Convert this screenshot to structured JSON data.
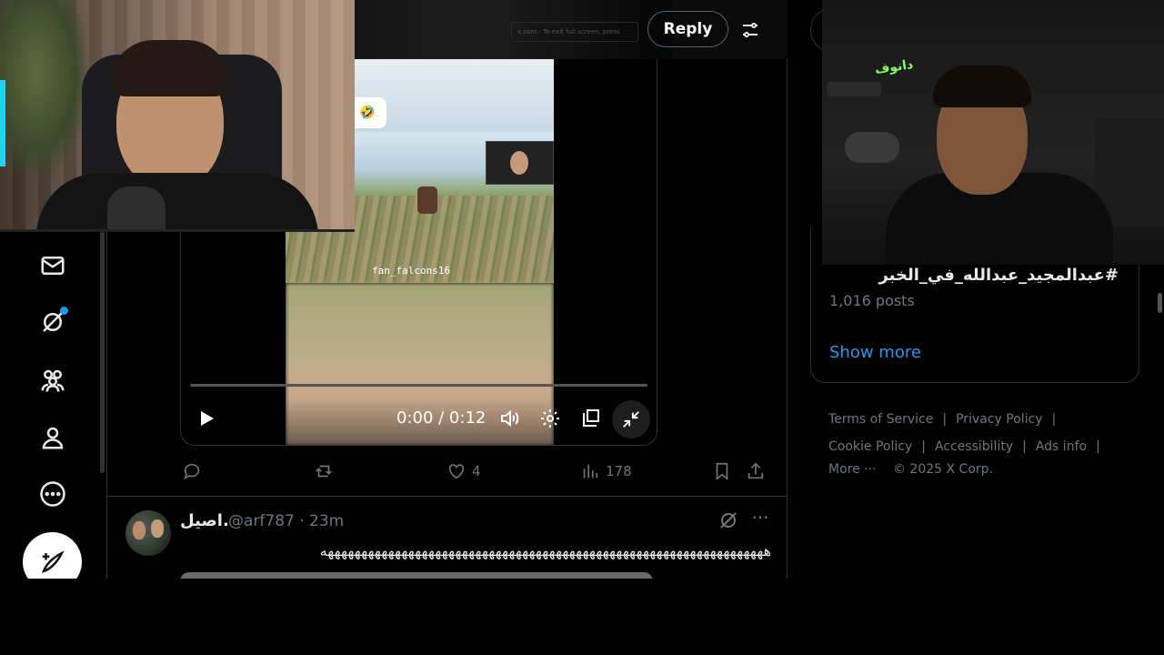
{
  "top_bar": {
    "reply_label": "Reply",
    "hint_text": "x.com - To exit full screen, press"
  },
  "video": {
    "caption_text": "ما توقع النتيجة 🤣",
    "watermark": "fan_falcons16",
    "time_label": "0:00 / 0:12",
    "progress": 0
  },
  "actions": {
    "like_count": "4",
    "view_count": "178"
  },
  "tweet2": {
    "display_name": "اصيل.",
    "handle_time": "@arf787 · 23m",
    "text": "ههههههههههههههههههههههههههههههههههههههههههههههههههههههههههههههههههه"
  },
  "trend": {
    "hashtag": "#عبدالمجيد_عبدالله_في_الخبر",
    "post_count": "1,016 posts",
    "show_more": "Show more"
  },
  "footer": {
    "terms": "Terms of Service",
    "privacy": "Privacy Policy",
    "cookie": "Cookie Policy",
    "accessibility": "Accessibility",
    "ads_info": "Ads info",
    "more": "More ···",
    "copyright": "© 2025 X Corp."
  },
  "overlays": {
    "cam2_logo": "دانوف"
  },
  "colors": {
    "accent": "#1d9bf0",
    "background": "#000000",
    "muted": "#71767b"
  }
}
